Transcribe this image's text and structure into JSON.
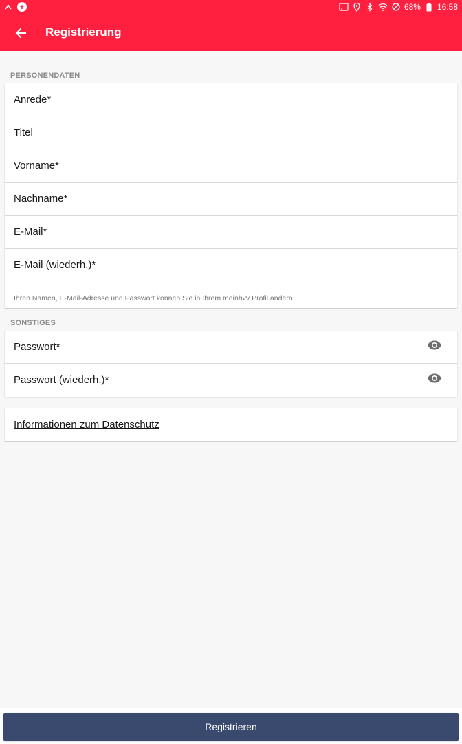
{
  "status_bar": {
    "battery": "68%",
    "time": "16:58"
  },
  "header": {
    "title": "Registrierung"
  },
  "personal_data": {
    "section_label": "PERSONENDATEN",
    "fields": [
      "Anrede*",
      "Titel",
      "Vorname*",
      "Nachname*",
      "E-Mail*",
      "E-Mail (wiederh.)*"
    ],
    "hint": "Ihren Namen, E-Mail-Adresse und Passwort können Sie in Ihrem meinhvv Profil ändern."
  },
  "other": {
    "section_label": "SONSTIGES",
    "fields": [
      "Passwort*",
      "Passwort (wiederh.)*"
    ]
  },
  "privacy_link": "Informationen zum Datenschutz",
  "register_button": "Registrieren",
  "colors": {
    "primary": "#ff2040",
    "button": "#3a4a6e",
    "background": "#f7f7f7"
  }
}
